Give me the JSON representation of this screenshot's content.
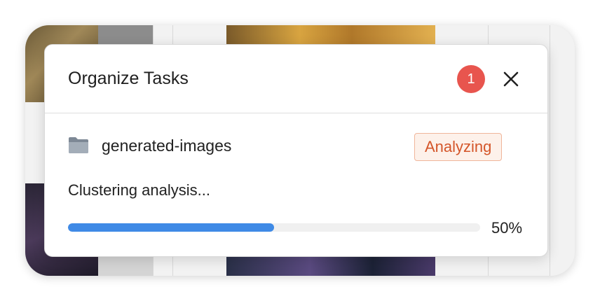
{
  "dialog": {
    "title": "Organize Tasks",
    "badge_count": "1",
    "close_icon": "close-icon"
  },
  "task": {
    "folder_icon": "folder-icon",
    "folder_name": "generated-images",
    "status": "Analyzing",
    "status_text": "Clustering analysis...",
    "progress": 0.5,
    "progress_label": "50%"
  },
  "colors": {
    "badge": "#e8554e",
    "progress": "#3f8ae6",
    "status_text": "#d4562a",
    "status_bg": "#fdf1ea",
    "status_border": "#f0b59a"
  }
}
